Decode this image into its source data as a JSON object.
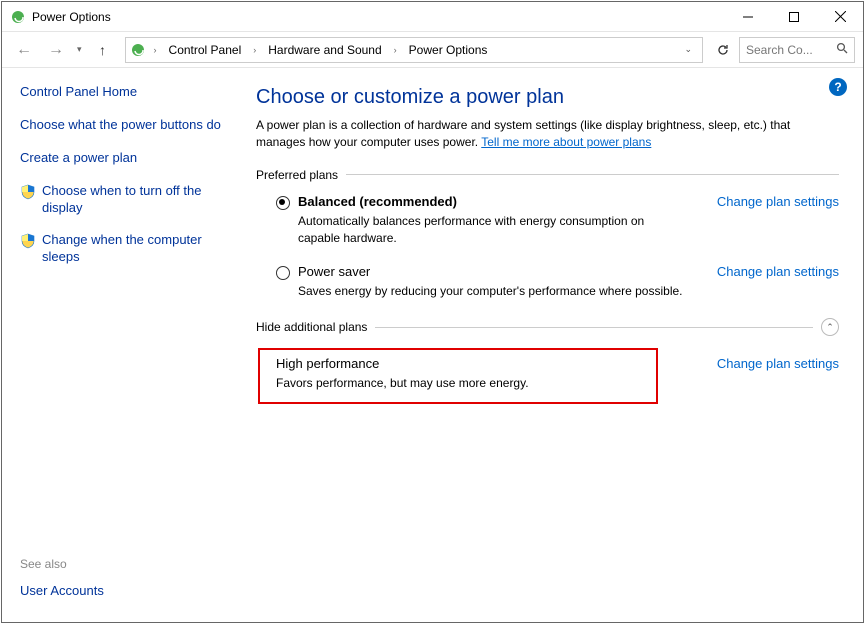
{
  "window": {
    "title": "Power Options"
  },
  "breadcrumb": {
    "items": [
      "Control Panel",
      "Hardware and Sound",
      "Power Options"
    ]
  },
  "search": {
    "placeholder": "Search Co..."
  },
  "sidebar": {
    "home": "Control Panel Home",
    "links": [
      "Choose what the power buttons do",
      "Create a power plan",
      "Choose when to turn off the display",
      "Change when the computer sleeps"
    ],
    "see_also_label": "See also",
    "see_also_links": [
      "User Accounts"
    ]
  },
  "content": {
    "title": "Choose or customize a power plan",
    "desc_a": "A power plan is a collection of hardware and system settings (like display brightness, sleep, etc.) that manages how your computer uses power. ",
    "desc_link": "Tell me more about power plans",
    "section_preferred": "Preferred plans",
    "section_additional": "Hide additional plans",
    "change_label": "Change plan settings",
    "plans": {
      "balanced": {
        "name": "Balanced (recommended)",
        "desc": "Automatically balances performance with energy consumption on capable hardware."
      },
      "power_saver": {
        "name": "Power saver",
        "desc": "Saves energy by reducing your computer's performance where possible."
      },
      "high_perf": {
        "name": "High performance",
        "desc": "Favors performance, but may use more energy."
      }
    }
  },
  "help_badge": "?"
}
